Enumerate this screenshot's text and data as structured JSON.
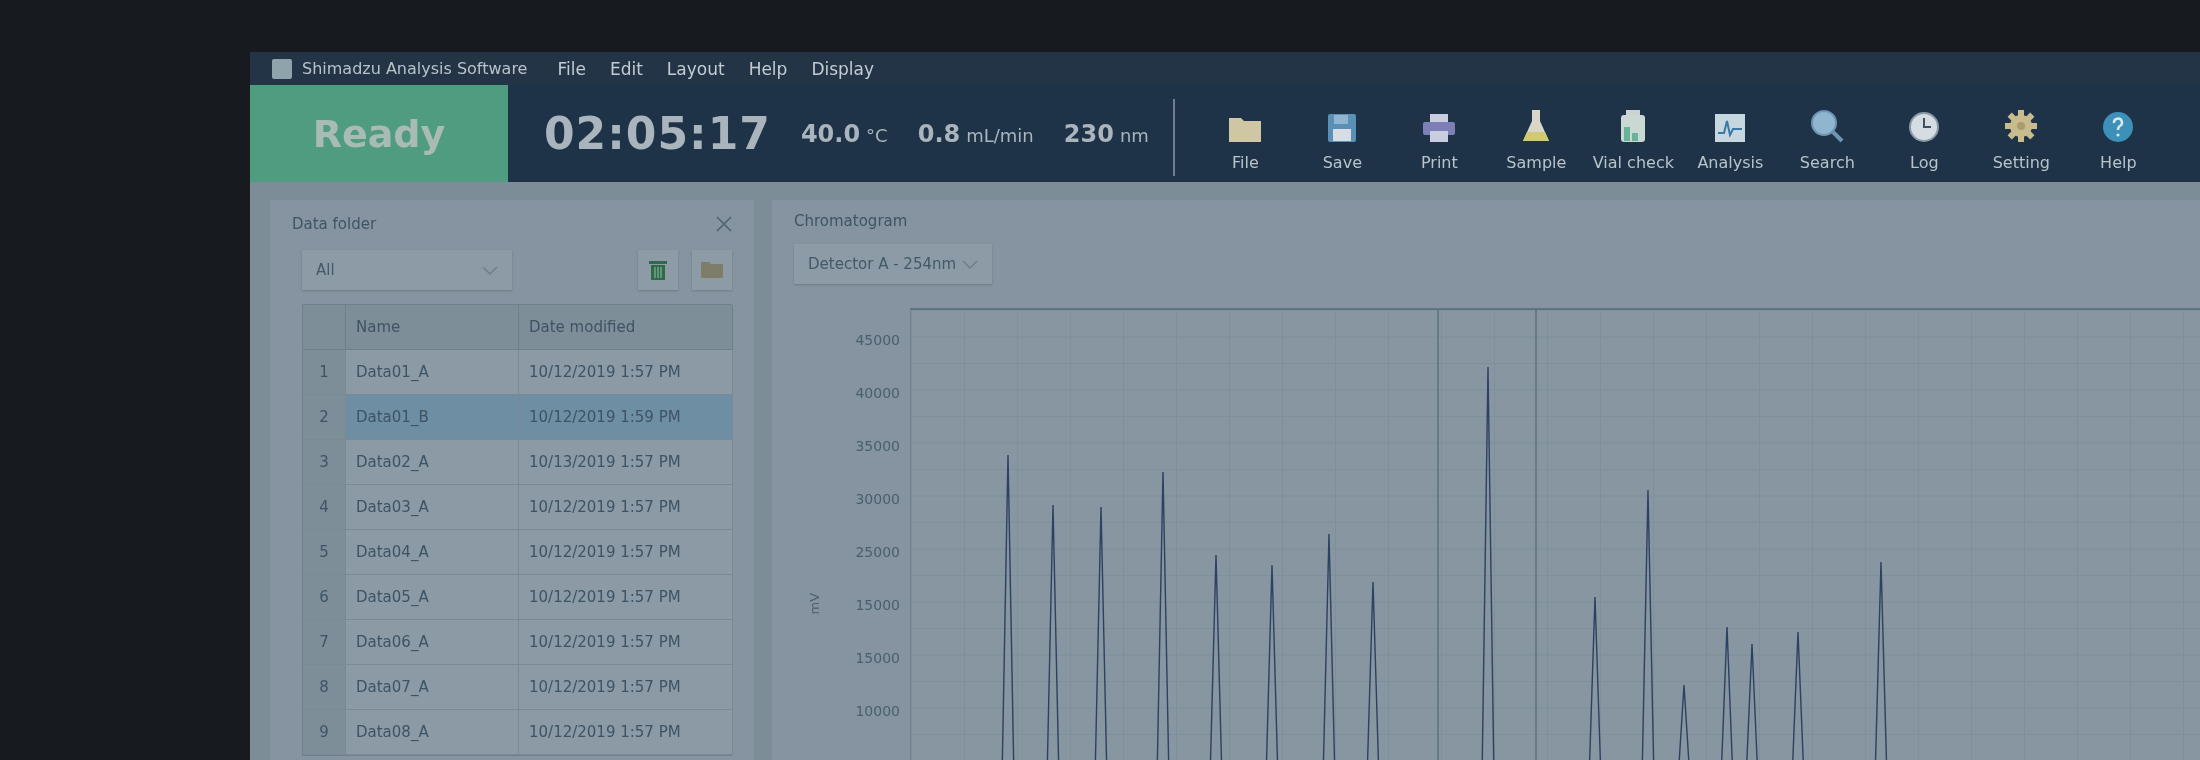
{
  "title_bar": {
    "app_name": "Shimadzu Analysis Software",
    "menu": [
      "File",
      "Edit",
      "Layout",
      "Help",
      "Display"
    ]
  },
  "status": {
    "state": "Ready",
    "time": "02:05:17",
    "readings": [
      {
        "value": "40.0",
        "unit": "°C"
      },
      {
        "value": "0.8",
        "unit": "mL/min"
      },
      {
        "value": "230",
        "unit": "nm"
      }
    ]
  },
  "toolbar": [
    {
      "label": "File"
    },
    {
      "label": "Save"
    },
    {
      "label": "Print"
    },
    {
      "label": "Sample"
    },
    {
      "label": "Vial check"
    },
    {
      "label": "Analysis"
    },
    {
      "label": "Search"
    },
    {
      "label": "Log"
    },
    {
      "label": "Setting"
    },
    {
      "label": "Help"
    }
  ],
  "data_folder": {
    "title": "Data folder",
    "filter": "All",
    "columns": [
      "Name",
      "Date modified"
    ],
    "rows": [
      {
        "index": "1",
        "name": "Data01_A",
        "date": "10/12/2019 1:57 PM",
        "selected": false
      },
      {
        "index": "2",
        "name": "Data01_B",
        "date": "10/12/2019 1:59 PM",
        "selected": true
      },
      {
        "index": "3",
        "name": "Data02_A",
        "date": "10/13/2019 1:57 PM",
        "selected": false
      },
      {
        "index": "4",
        "name": "Data03_A",
        "date": "10/12/2019 1:57 PM",
        "selected": false
      },
      {
        "index": "5",
        "name": "Data04_A",
        "date": "10/12/2019 1:57 PM",
        "selected": false
      },
      {
        "index": "6",
        "name": "Data05_A",
        "date": "10/12/2019 1:57 PM",
        "selected": false
      },
      {
        "index": "7",
        "name": "Data06_A",
        "date": "10/12/2019 1:57 PM",
        "selected": false
      },
      {
        "index": "8",
        "name": "Data07_A",
        "date": "10/12/2019 1:57 PM",
        "selected": false
      },
      {
        "index": "9",
        "name": "Data08_A",
        "date": "10/12/2019 1:57 PM",
        "selected": false
      }
    ]
  },
  "chromatogram": {
    "title": "Chromatogram",
    "detector": "Detector A - 254nm",
    "ylabel": "mV",
    "yticks": [
      "45000",
      "40000",
      "35000",
      "30000",
      "25000",
      "15000",
      "15000",
      "10000"
    ]
  }
}
